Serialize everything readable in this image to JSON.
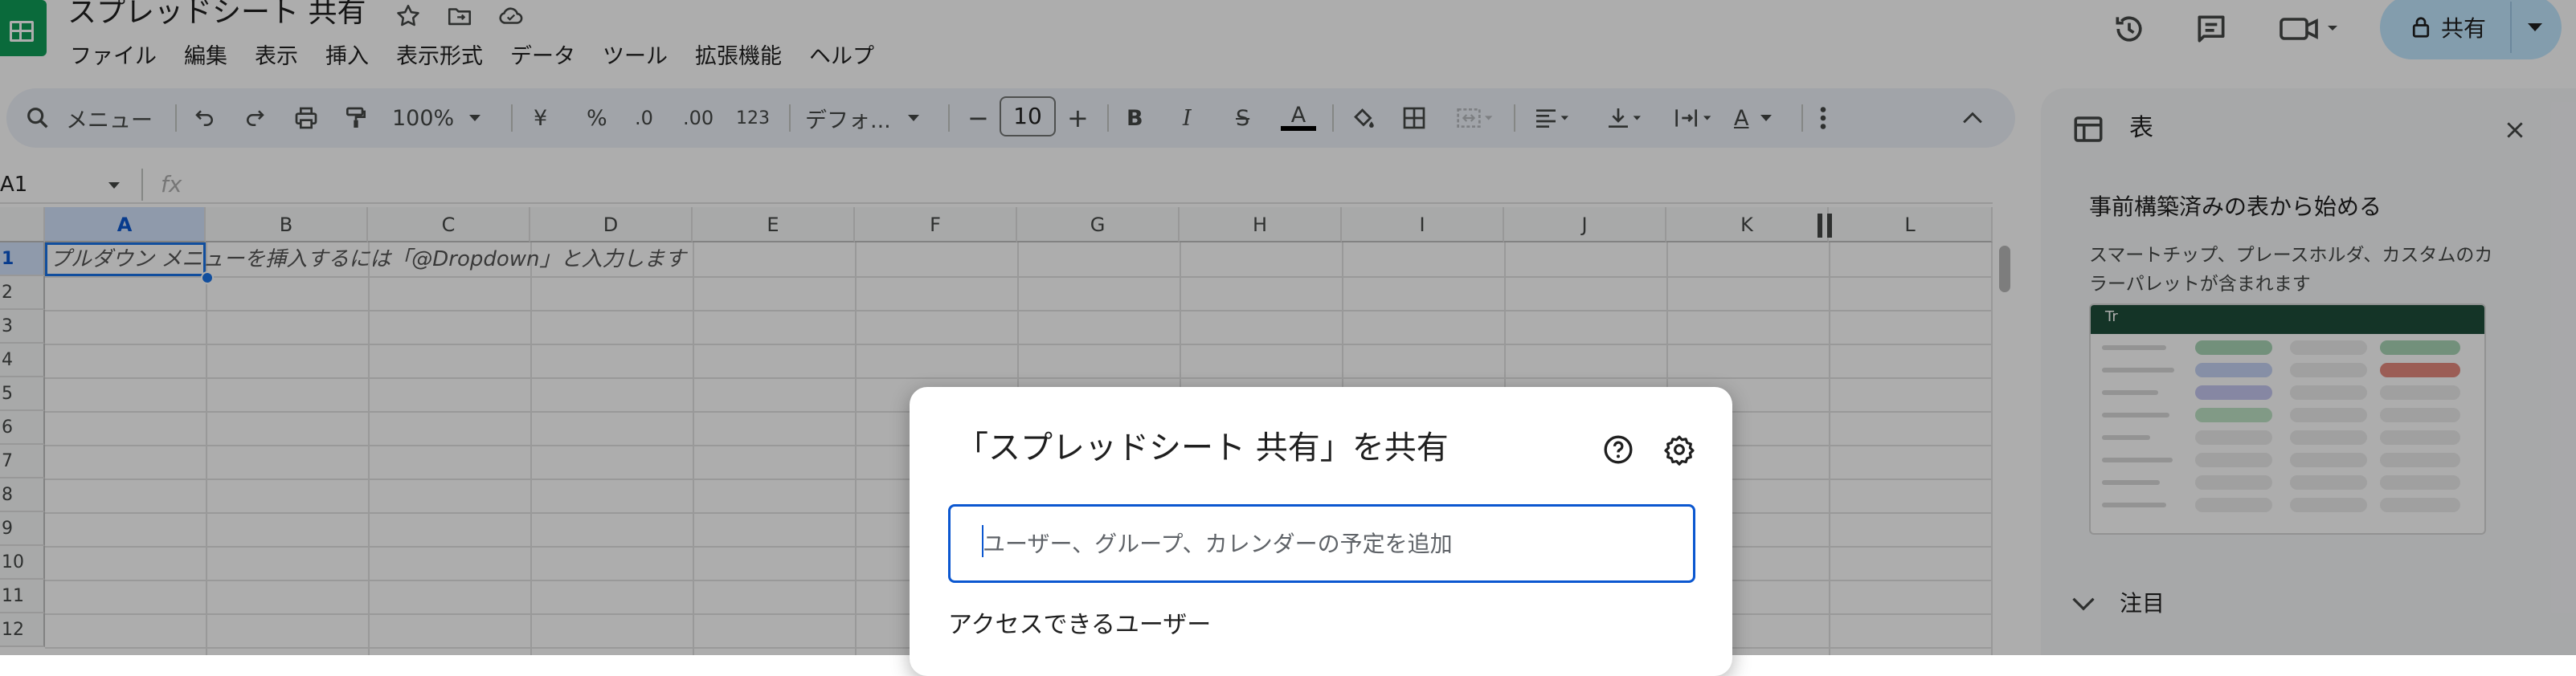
{
  "window": {
    "title": "スプレッドシート 共有",
    "share_label": "共有"
  },
  "menu": [
    "ファイル",
    "編集",
    "表示",
    "挿入",
    "表示形式",
    "データ",
    "ツール",
    "拡張機能",
    "ヘルプ"
  ],
  "toolbar": {
    "search_menu": "メニュー",
    "zoom": "100%",
    "currency": "¥",
    "percent": "%",
    "decrease_decimal": ".0",
    "increase_decimal": ".00",
    "number_format": "123",
    "font": "デフォ...",
    "font_size": "10",
    "minus": "−",
    "plus": "+",
    "bold": "B",
    "italic": "I",
    "strike": "S",
    "text_color": "A",
    "text_format": "A"
  },
  "formula_bar": {
    "cell_ref": "A1",
    "fx": "fx"
  },
  "sheet": {
    "columns": [
      "A",
      "B",
      "C",
      "D",
      "E",
      "F",
      "G",
      "H",
      "I",
      "J",
      "K",
      "L"
    ],
    "rows": [
      "1",
      "2",
      "3",
      "4",
      "5",
      "6",
      "7",
      "8",
      "9",
      "10",
      "11",
      "12"
    ],
    "hint_text": "プルダウン メニューを挿入するには「@Dropdown」と入力します"
  },
  "side_panel": {
    "title": "表",
    "subtitle": "事前構築済みの表から始める",
    "description": "スマートチップ、プレースホルダ、カスタムのカラーパレットが含まれます",
    "preview_header": "Tr",
    "section": "注目"
  },
  "share_dialog": {
    "title": "「スプレッドシート 共有」を共有",
    "input_value": "",
    "input_placeholder": "ユーザー、グループ、カレンダーの予定を追加",
    "access_heading": "アクセスできるユーザー"
  },
  "colors": {
    "accent": "#0b57d0",
    "share_button": "#c2e7ff",
    "sheets_green": "#0f9d58",
    "selection": "#1a73e8"
  },
  "icons": [
    "sheets-logo-icon",
    "star-icon",
    "move-folder-icon",
    "cloud-status-icon",
    "history-icon",
    "comment-icon",
    "meet-icon",
    "lock-icon",
    "search-icon",
    "undo-icon",
    "redo-icon",
    "print-icon",
    "paint-format-icon",
    "fill-color-icon",
    "borders-icon",
    "merge-icon",
    "align-icon",
    "valign-icon",
    "text-wrap-icon",
    "more-icon",
    "collapse-icon",
    "table-icon",
    "close-icon",
    "chevron-down-icon",
    "help-icon",
    "settings-icon"
  ]
}
